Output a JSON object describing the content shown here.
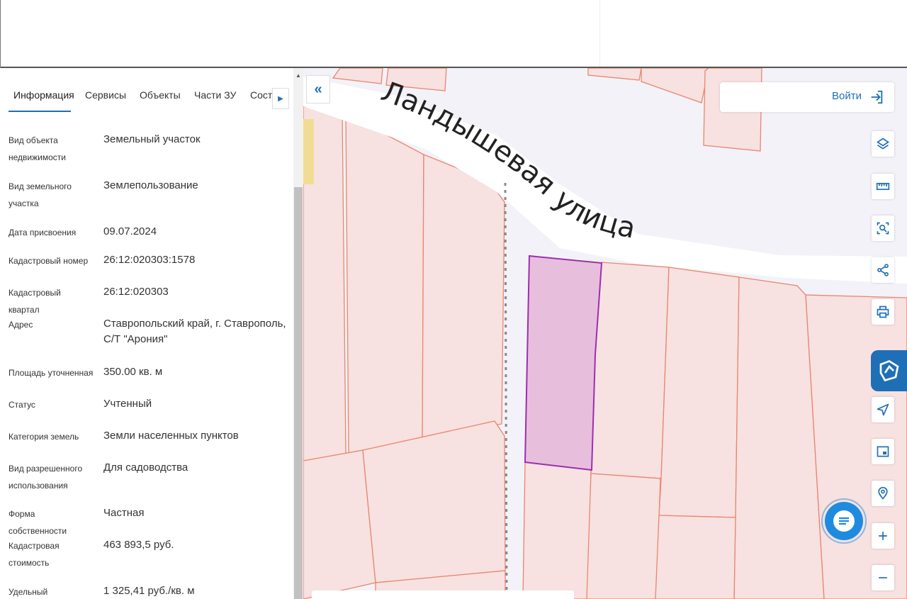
{
  "tabs": [
    {
      "label": "Информация"
    },
    {
      "label": "Сервисы"
    },
    {
      "label": "Объекты"
    },
    {
      "label": "Части ЗУ"
    },
    {
      "label": "Соста"
    }
  ],
  "info": {
    "object_type": {
      "label": "Вид объекта недвижимости",
      "value": "Земельный участок"
    },
    "parcel_type": {
      "label": "Вид земельного участка",
      "value": "Землепользование"
    },
    "date": {
      "label": "Дата присвоения",
      "value": "09.07.2024"
    },
    "cad_number": {
      "label": "Кадастровый номер",
      "value": "26:12:020303:1578"
    },
    "cad_quarter": {
      "label": "Кадастровый квартал",
      "value": "26:12:020303"
    },
    "address": {
      "label": "Адрес",
      "value": "Ставропольский край, г. Ставрополь, С/Т \"Арония\""
    },
    "area": {
      "label": "Площадь уточненная",
      "value": "350.00 кв. м"
    },
    "status": {
      "label": "Статус",
      "value": "Учтенный"
    },
    "category": {
      "label": "Категория земель",
      "value": "Земли населенных пунктов"
    },
    "usage": {
      "label": "Вид разрешенного использования",
      "value": "Для садоводства"
    },
    "ownership": {
      "label": "Форма собственности",
      "value": "Частная"
    },
    "cad_value": {
      "label": "Кадастровая стоимость",
      "value": "463 893,5 руб."
    },
    "specific": {
      "label": "Удельный показатель",
      "value": "1 325,41 руб./кв. м"
    }
  },
  "map": {
    "street_label": "Ландышевая улица",
    "login_label": "Войти",
    "colors": {
      "parcel_fill": "#f7e1e1",
      "parcel_stroke": "#e8876f",
      "selected_fill": "#e8bedd",
      "selected_stroke": "#9c2fb0",
      "accent": "#1f6fb7"
    }
  },
  "tools": [
    "layers-icon",
    "ruler-icon",
    "select-area-icon",
    "share-icon",
    "print-icon",
    "gosuslugi-icon",
    "locate-icon",
    "minimap-icon",
    "pin-search-icon",
    "zoom-in-icon",
    "zoom-out-icon",
    "chat-icon"
  ]
}
